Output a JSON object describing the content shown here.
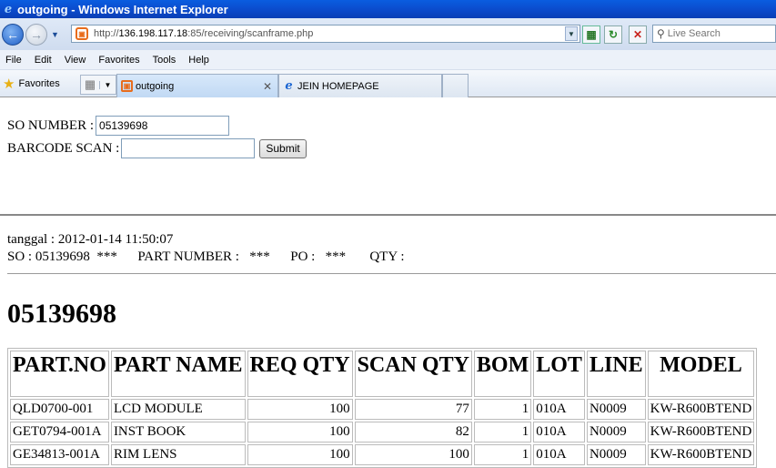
{
  "window": {
    "title": "outgoing - Windows Internet Explorer"
  },
  "address": {
    "url_prefix": "http://",
    "url_host": "136.198.117.18",
    "url_rest": ":85/receiving/scanframe.php",
    "search_placeholder": "Live Search"
  },
  "menu": [
    "File",
    "Edit",
    "View",
    "Favorites",
    "Tools",
    "Help"
  ],
  "favorites": {
    "label": "Favorites",
    "tabs": [
      {
        "label": "outgoing",
        "active": true
      },
      {
        "label": "JEIN HOMEPAGE",
        "active": false
      }
    ]
  },
  "form": {
    "so_label": "SO NUMBER :",
    "so_value": "05139698",
    "barcode_label": "BARCODE SCAN :",
    "barcode_value": "",
    "submit_label": "Submit"
  },
  "info": {
    "tanggal_line": "tanggal : 2012-01-14 11:50:07",
    "so_line": "SO : 05139698  ***      PART NUMBER :   ***      PO :   ***       QTY :"
  },
  "so_heading": "05139698",
  "table": {
    "headers": [
      "PART.NO",
      "PART NAME",
      "REQ QTY",
      "SCAN QTY",
      "BOM",
      "LOT",
      "LINE",
      "MODEL"
    ],
    "rows": [
      [
        "QLD0700-001",
        "LCD MODULE",
        "100",
        "77",
        "1",
        "010A",
        "N0009",
        "KW-R600BTEND"
      ],
      [
        "GET0794-001A",
        "INST BOOK",
        "100",
        "82",
        "1",
        "010A",
        "N0009",
        "KW-R600BTEND"
      ],
      [
        "GE34813-001A",
        "RIM LENS",
        "100",
        "100",
        "1",
        "010A",
        "N0009",
        "KW-R600BTEND"
      ]
    ]
  }
}
